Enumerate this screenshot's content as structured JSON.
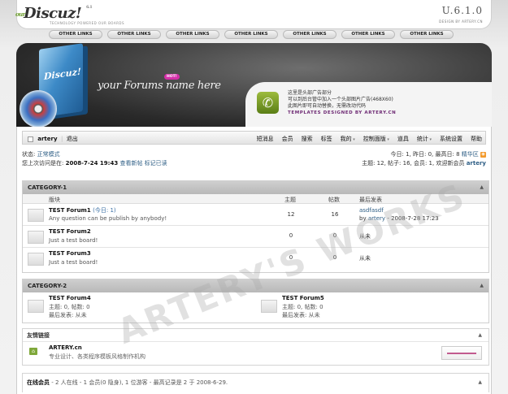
{
  "header": {
    "logo_prefix": "our",
    "logo_text": "Discuz!",
    "logo_version": "6.1",
    "tagline": "TECHNOLOGY POWERED OUR BOARDS",
    "version_mark": "U.6.1.0",
    "design_by": "DESIGN BY ARTERY.CN"
  },
  "other_links": [
    "OTHER LINKS",
    "OTHER LINKS",
    "OTHER LINKS",
    "OTHER LINKS",
    "OTHER LINKS",
    "OTHER LINKS",
    "OTHER LINKS"
  ],
  "banner": {
    "box_label": "Discuz!",
    "hot_badge": "HOT!",
    "forum_name": "your Forums name here",
    "ad_line1": "这里是头部广告部分",
    "ad_line2": "可以到后台管中加入一个头部图片广告(468X60)",
    "ad_line3": "此图片即可自动替换，无需改动代码",
    "ad_template": "TEMPLATES DESIGNED BY ARTERY.CN",
    "phone_icon": "phone-icon"
  },
  "navbar": {
    "username": "artery",
    "logout": "退出",
    "menu": [
      {
        "label": "短消息",
        "dropdown": false
      },
      {
        "label": "会员",
        "dropdown": false
      },
      {
        "label": "搜索",
        "dropdown": false
      },
      {
        "label": "标签",
        "dropdown": false
      },
      {
        "label": "我的",
        "dropdown": true
      },
      {
        "label": "控制面版",
        "dropdown": true
      },
      {
        "label": "道具",
        "dropdown": false
      },
      {
        "label": "统计",
        "dropdown": true
      },
      {
        "label": "系统设置",
        "dropdown": false
      },
      {
        "label": "帮助",
        "dropdown": false
      }
    ]
  },
  "status": {
    "state_label": "状态:",
    "state_value": "正常模式",
    "last_visit_label": "您上次访问是在:",
    "last_visit_value": "2008-7-24 19:43",
    "view_new": "查看新帖",
    "mark_read": "标记已读",
    "today_line": "今日: 1, 昨日: 0, 最高日: 8",
    "digest": "精华区",
    "stats_line": "主题: 12, 帖子: 16, 会员: 1, 欢迎新会员",
    "new_member": "artery"
  },
  "category1": {
    "title": "CATEGORY-1",
    "columns": {
      "forum": "版块",
      "topics": "主题",
      "posts": "帖数",
      "last": "最后发表"
    },
    "forums": [
      {
        "name": "TEST Forum1",
        "today": "(今日: 1)",
        "desc": "Any question can be publish by anybody!",
        "topics": "12",
        "posts": "16",
        "last_title": "asdfasdf",
        "last_by": "by",
        "last_user": "artery",
        "last_time": "- 2008-7-28 17:23"
      },
      {
        "name": "TEST Forum2",
        "today": "",
        "desc": "Just a test board!",
        "topics": "0",
        "posts": "0",
        "last_title": "从未",
        "last_by": "",
        "last_user": "",
        "last_time": ""
      },
      {
        "name": "TEST Forum3",
        "today": "",
        "desc": "Just a test board!",
        "topics": "0",
        "posts": "0",
        "last_title": "从未",
        "last_by": "",
        "last_user": "",
        "last_time": ""
      }
    ]
  },
  "category2": {
    "title": "CATEGORY-2",
    "forums": [
      {
        "name": "TEST Forum4",
        "stats": "主题: 0, 帖数: 0",
        "last": "最后发表: 从未"
      },
      {
        "name": "TEST Forum5",
        "stats": "主题: 0, 帖数: 0",
        "last": "最后发表: 从未"
      }
    ]
  },
  "friend_links": {
    "title": "友情链接",
    "site_name": "ARTERY.cn",
    "site_desc": "专业设计、各类程序模板风格制作机构"
  },
  "online": {
    "title": "在线会员",
    "text": "- 2 人在线 - 1 会员(0 隐身), 1 位游客 - 最高记录是 2 于 2008-6-29."
  },
  "watermark": "ARTERY'S WORKS"
}
